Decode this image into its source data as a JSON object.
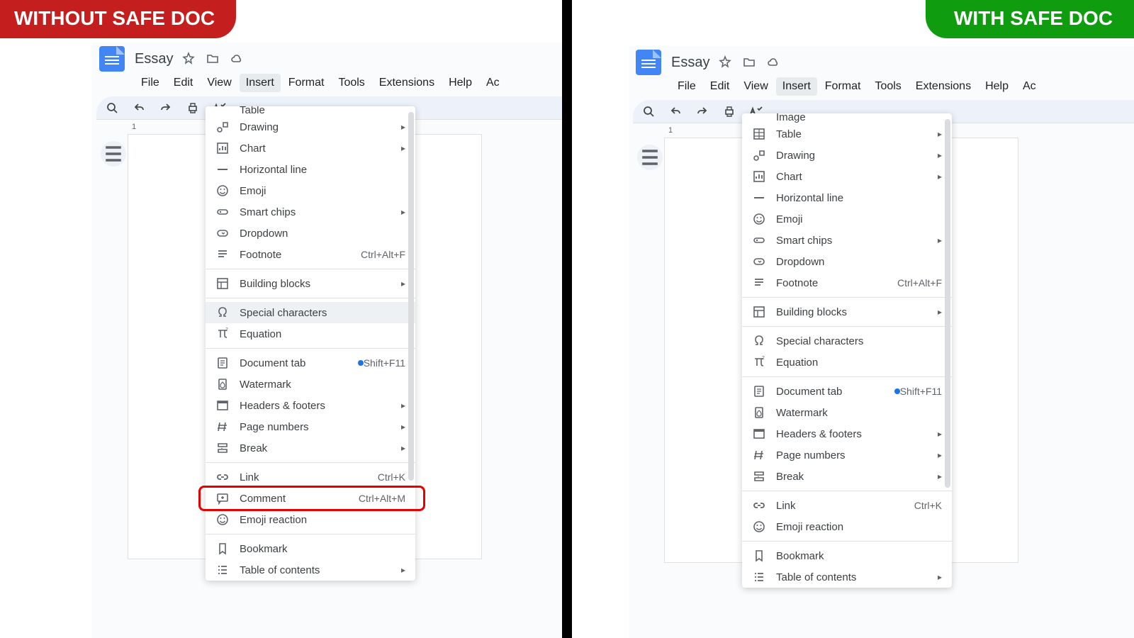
{
  "badges": {
    "left": "WITHOUT SAFE DOC",
    "right": "WITH SAFE DOC"
  },
  "doc": {
    "title": "Essay",
    "menus": [
      "File",
      "Edit",
      "View",
      "Insert",
      "Format",
      "Tools",
      "Extensions",
      "Help",
      "Ac"
    ],
    "active_menu_index": 3,
    "ruler_mark": "1"
  },
  "left_menu": {
    "truncated_top": "Table",
    "groups": [
      [
        {
          "icon": "drawing",
          "label": "Drawing",
          "submenu": true
        },
        {
          "icon": "chart",
          "label": "Chart",
          "submenu": true
        },
        {
          "icon": "hline",
          "label": "Horizontal line"
        },
        {
          "icon": "emoji",
          "label": "Emoji"
        },
        {
          "icon": "chips",
          "label": "Smart chips",
          "submenu": true
        },
        {
          "icon": "dropdown",
          "label": "Dropdown"
        },
        {
          "icon": "footnote",
          "label": "Footnote",
          "shortcut": "Ctrl+Alt+F"
        }
      ],
      [
        {
          "icon": "blocks",
          "label": "Building blocks",
          "submenu": true
        }
      ],
      [
        {
          "icon": "omega",
          "label": "Special characters",
          "hover": true
        },
        {
          "icon": "pi",
          "label": "Equation"
        }
      ],
      [
        {
          "icon": "doctab",
          "label": "Document tab",
          "dot": true,
          "shortcut": "Shift+F11"
        },
        {
          "icon": "watermark",
          "label": "Watermark"
        },
        {
          "icon": "headers",
          "label": "Headers & footers",
          "submenu": true
        },
        {
          "icon": "hash",
          "label": "Page numbers",
          "submenu": true
        },
        {
          "icon": "break",
          "label": "Break",
          "submenu": true
        }
      ],
      [
        {
          "icon": "link",
          "label": "Link",
          "shortcut": "Ctrl+K"
        },
        {
          "icon": "comment",
          "label": "Comment",
          "shortcut": "Ctrl+Alt+M",
          "redbox": true
        },
        {
          "icon": "emoji",
          "label": "Emoji reaction"
        }
      ],
      [
        {
          "icon": "bookmark",
          "label": "Bookmark"
        },
        {
          "icon": "toc",
          "label": "Table of contents",
          "submenu": true
        }
      ]
    ]
  },
  "right_menu": {
    "truncated_top": "Image",
    "groups": [
      [
        {
          "icon": "table",
          "label": "Table",
          "submenu": true
        },
        {
          "icon": "drawing",
          "label": "Drawing",
          "submenu": true
        },
        {
          "icon": "chart",
          "label": "Chart",
          "submenu": true
        },
        {
          "icon": "hline",
          "label": "Horizontal line"
        },
        {
          "icon": "emoji",
          "label": "Emoji"
        },
        {
          "icon": "chips",
          "label": "Smart chips",
          "submenu": true
        },
        {
          "icon": "dropdown",
          "label": "Dropdown"
        },
        {
          "icon": "footnote",
          "label": "Footnote",
          "shortcut": "Ctrl+Alt+F"
        }
      ],
      [
        {
          "icon": "blocks",
          "label": "Building blocks",
          "submenu": true
        }
      ],
      [
        {
          "icon": "omega",
          "label": "Special characters"
        },
        {
          "icon": "pi",
          "label": "Equation"
        }
      ],
      [
        {
          "icon": "doctab",
          "label": "Document tab",
          "dot": true,
          "shortcut": "Shift+F11"
        },
        {
          "icon": "watermark",
          "label": "Watermark"
        },
        {
          "icon": "headers",
          "label": "Headers & footers",
          "submenu": true
        },
        {
          "icon": "hash",
          "label": "Page numbers",
          "submenu": true
        },
        {
          "icon": "break",
          "label": "Break",
          "submenu": true
        }
      ],
      [
        {
          "icon": "link",
          "label": "Link",
          "shortcut": "Ctrl+K"
        },
        {
          "icon": "emoji",
          "label": "Emoji reaction"
        }
      ],
      [
        {
          "icon": "bookmark",
          "label": "Bookmark"
        },
        {
          "icon": "toc",
          "label": "Table of contents",
          "submenu": true
        }
      ]
    ]
  }
}
